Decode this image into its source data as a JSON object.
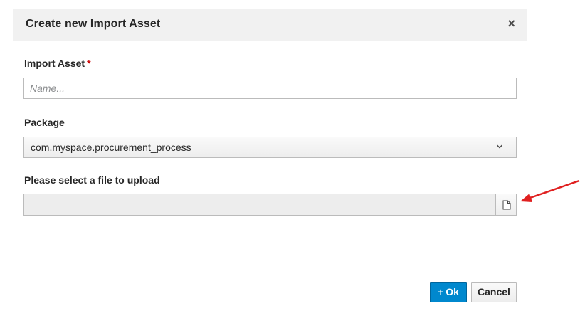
{
  "dialog": {
    "title": "Create new Import Asset",
    "close_glyph": "×"
  },
  "import_asset": {
    "label": "Import Asset",
    "required_marker": "*",
    "placeholder": "Name...",
    "value": ""
  },
  "package": {
    "label": "Package",
    "selected": "com.myspace.procurement_process",
    "chevron_glyph": "⌄"
  },
  "file_upload": {
    "label": "Please select a file to upload",
    "value": "",
    "browse_icon": "file-icon"
  },
  "annotation": {
    "arrow_color": "#e02020"
  },
  "footer": {
    "ok_icon": "+",
    "ok_label": "Ok",
    "cancel_label": "Cancel"
  },
  "colors": {
    "primary": "#0088ce",
    "header_bg": "#f1f1f1",
    "required": "#cc0000"
  }
}
